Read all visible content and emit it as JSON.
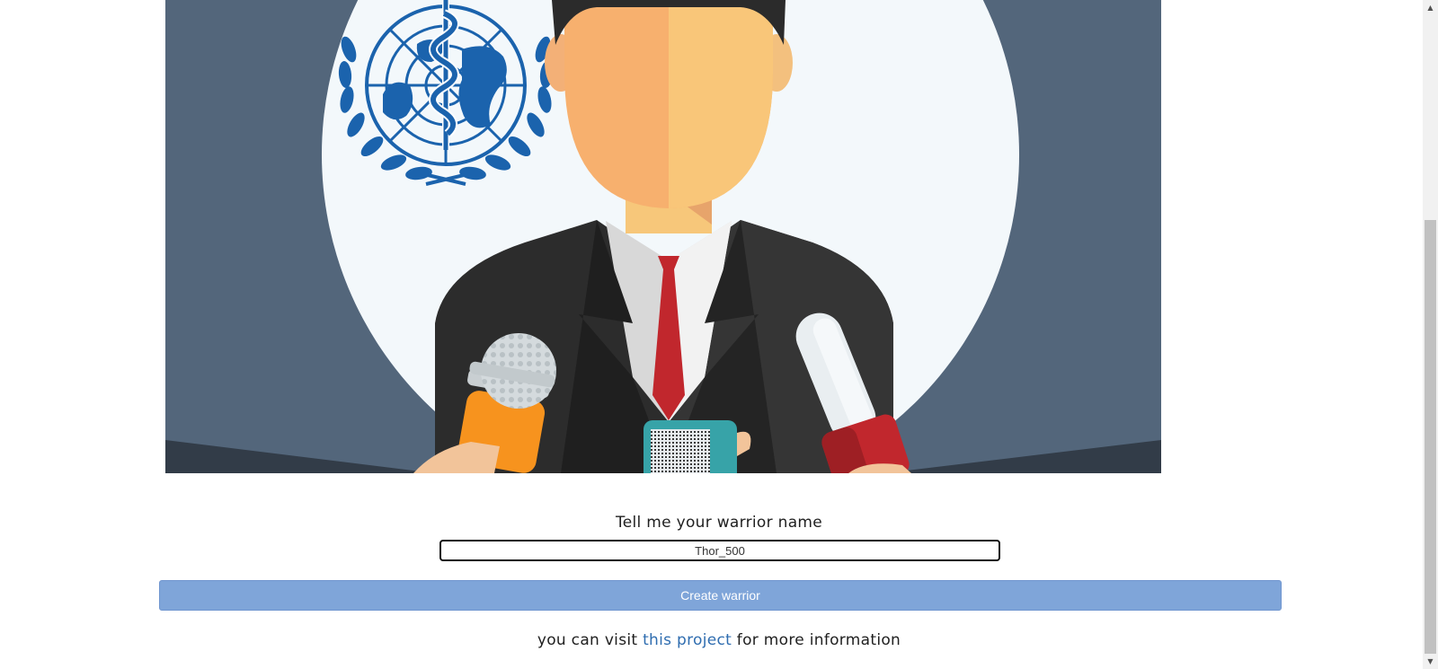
{
  "hero": {
    "logo_alt": "World Health Organization emblem"
  },
  "form": {
    "prompt": "Tell me your warrior name",
    "name_value": "Thor_500",
    "create_label": "Create warrior"
  },
  "footer": {
    "prefix": "you can visit ",
    "link_text": "this project",
    "suffix": " for more information"
  },
  "scrollbar": {
    "up_icon": "▲",
    "down_icon": "▼"
  },
  "colors": {
    "hero_background": "#53667b",
    "button": "#7fa5d9",
    "link": "#2f6db0",
    "who_blue": "#1b63ad"
  }
}
